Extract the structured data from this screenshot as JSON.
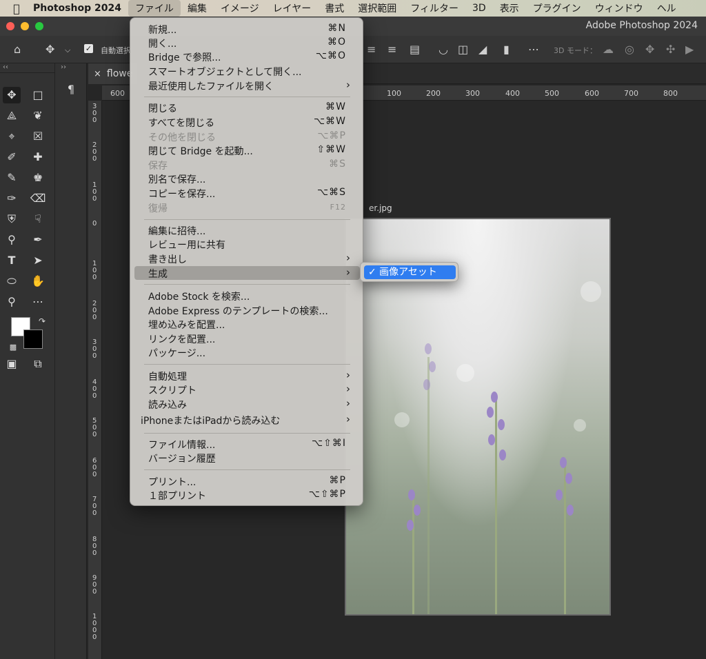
{
  "menubar": {
    "app_name": "Photoshop 2024",
    "items": [
      "ファイル",
      "編集",
      "イメージ",
      "レイヤー",
      "書式",
      "選択範囲",
      "フィルター",
      "3D",
      "表示",
      "プラグイン",
      "ウィンドウ",
      "ヘル"
    ]
  },
  "window": {
    "title": "Adobe Photoshop 2024"
  },
  "options_bar": {
    "auto_select_label": "自動選択",
    "mode_3d_label": "3D モード："
  },
  "document": {
    "tab_label": "flowe",
    "name_fragment": "er.jpg"
  },
  "rulers": {
    "horizontal": [
      "600",
      "100",
      "200",
      "300",
      "400",
      "500",
      "600",
      "700",
      "800"
    ],
    "vertical": [
      "300",
      "200",
      "100",
      "0",
      "100",
      "200",
      "300",
      "400",
      "500",
      "600",
      "700",
      "800",
      "900",
      "1000"
    ]
  },
  "file_menu": {
    "items": [
      {
        "label": "新規...",
        "shortcut": "⌘N"
      },
      {
        "label": "開く...",
        "shortcut": "⌘O"
      },
      {
        "label": "Bridge で参照...",
        "shortcut": "⌥⌘O"
      },
      {
        "label": "スマートオブジェクトとして開く...",
        "shortcut": ""
      },
      {
        "label": "最近使用したファイルを開く",
        "shortcut": "",
        "submenu": true
      },
      {
        "label": "閉じる",
        "shortcut": "⌘W"
      },
      {
        "label": "すべてを閉じる",
        "shortcut": "⌥⌘W"
      },
      {
        "label": "その他を閉じる",
        "shortcut": "⌥⌘P",
        "disabled": true
      },
      {
        "label": "閉じて Bridge を起動...",
        "shortcut": "⇧⌘W"
      },
      {
        "label": "保存",
        "shortcut": "⌘S",
        "disabled": true
      },
      {
        "label": "別名で保存...",
        "shortcut": ""
      },
      {
        "label": "コピーを保存...",
        "shortcut": "⌥⌘S"
      },
      {
        "label": "復帰",
        "shortcut": "F12",
        "disabled": true
      },
      {
        "label": "編集に招待...",
        "shortcut": ""
      },
      {
        "label": "レビュー用に共有",
        "shortcut": ""
      },
      {
        "label": "書き出し",
        "shortcut": "",
        "submenu": true
      },
      {
        "label": "生成",
        "shortcut": "",
        "submenu": true,
        "highlighted": true
      },
      {
        "label": "Adobe Stock を検索...",
        "shortcut": ""
      },
      {
        "label": "Adobe Express のテンプレートの検索...",
        "shortcut": ""
      },
      {
        "label": "埋め込みを配置...",
        "shortcut": ""
      },
      {
        "label": "リンクを配置...",
        "shortcut": ""
      },
      {
        "label": "パッケージ...",
        "shortcut": ""
      },
      {
        "label": "自動処理",
        "shortcut": "",
        "submenu": true
      },
      {
        "label": "スクリプト",
        "shortcut": "",
        "submenu": true
      },
      {
        "label": "読み込み",
        "shortcut": "",
        "submenu": true
      },
      {
        "label": "iPhoneまたはiPadから読み込む",
        "shortcut": "",
        "submenu": true
      },
      {
        "label": "ファイル情報...",
        "shortcut": "⌥⇧⌘I"
      },
      {
        "label": "バージョン履歴",
        "shortcut": ""
      },
      {
        "label": "プリント...",
        "shortcut": "⌘P"
      },
      {
        "label": "１部プリント",
        "shortcut": "⌥⇧⌘P"
      }
    ]
  },
  "generate_submenu": {
    "item": "✓ 画像アセット"
  },
  "colors": {
    "highlight": "#2f7df0",
    "menu_bg": "#cdcbc7"
  }
}
